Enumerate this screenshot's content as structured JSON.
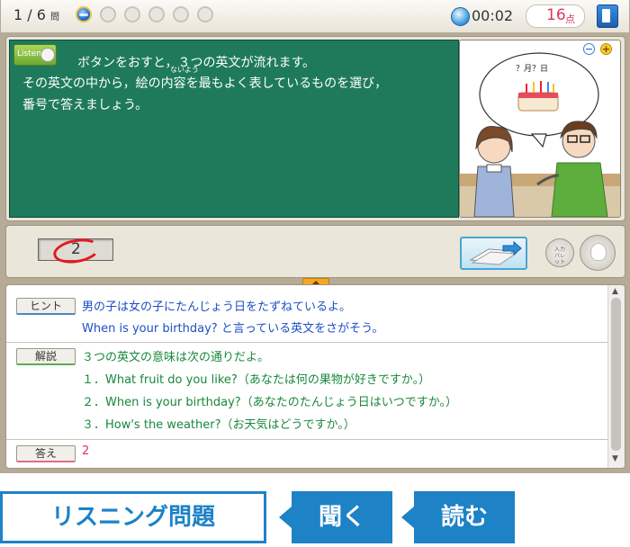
{
  "topbar": {
    "question_progress": "1 / 6",
    "question_unit": "問",
    "progress_dots": [
      {
        "state": "current"
      },
      {
        "state": "pending"
      },
      {
        "state": "pending"
      },
      {
        "state": "pending"
      },
      {
        "state": "pending"
      },
      {
        "state": "pending"
      }
    ],
    "timer": "00:02",
    "score_value": "16",
    "score_unit": "点"
  },
  "question": {
    "listen_label": "Listen",
    "lines": [
      "ボタンをおすと，３つの英文が流れます。",
      "その英文の中から，絵の内容を最もよく表しているものを選び，",
      "番号で答えましょう。"
    ],
    "furigana": "ないよう"
  },
  "picture": {
    "bubble_text": "？月？日"
  },
  "answer": {
    "selected_value": "2"
  },
  "input_palette_label": "入力パレット",
  "explanation": {
    "hint_tag": "ヒント",
    "hint_lines": [
      "男の子は女の子にたんじょう日をたずねているよ。",
      "When is your birthday? と言っている英文をさがそう。"
    ],
    "commentary_tag": "解説",
    "commentary_intro": "３つの英文の意味は次の通りだよ。",
    "commentary_items": [
      "１．What fruit do you like?（あなたは何の果物が好きですか。）",
      "２．When is your birthday?（あなたのたんじょう日はいつですか。）",
      "３．How's the weather?（お天気はどうですか。）"
    ],
    "answer_tag": "答え",
    "answer_value": "2"
  },
  "labels": {
    "main": "リスニング問題",
    "skill_1": "聞く",
    "skill_2": "読む"
  },
  "colors": {
    "board": "#1f7a5c",
    "accent_blue": "#1d82c6",
    "score_red": "#e0345a",
    "hint_blue": "#1d4fc4",
    "commentary_green": "#18873b"
  }
}
